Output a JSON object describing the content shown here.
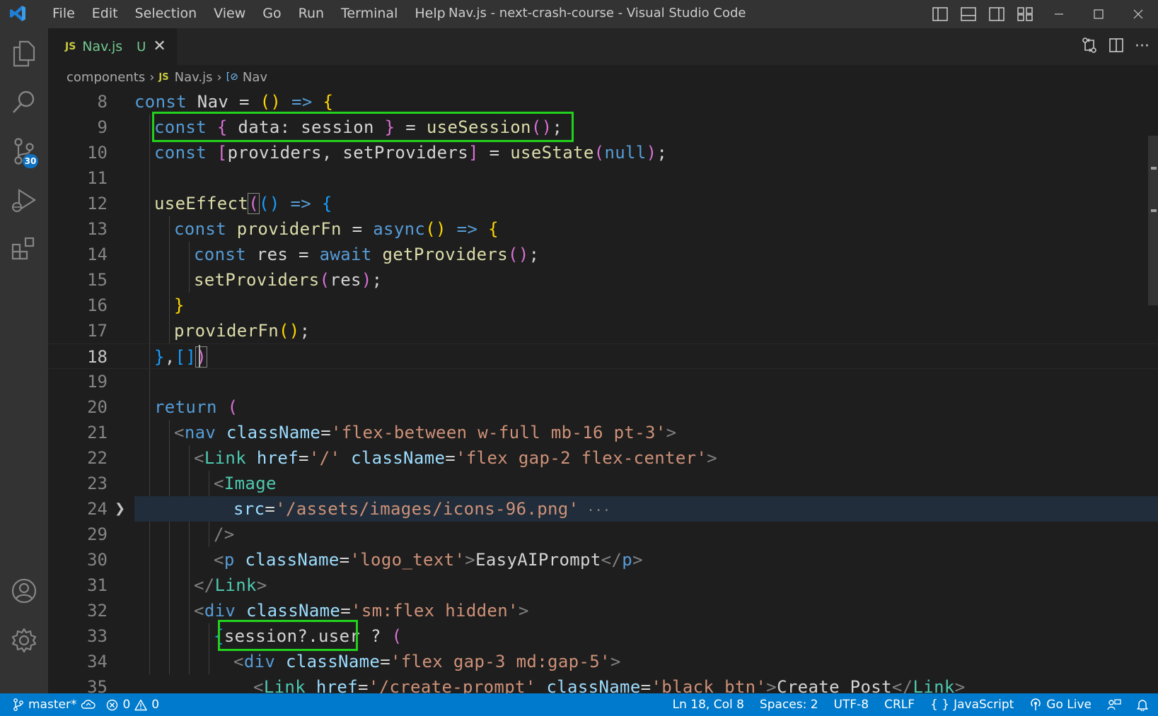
{
  "window": {
    "title": "Nav.js - next-crash-course - Visual Studio Code",
    "menu": [
      "File",
      "Edit",
      "Selection",
      "View",
      "Go",
      "Run",
      "Terminal",
      "Help"
    ]
  },
  "activity_bar": {
    "items": [
      "explorer-icon",
      "search-icon",
      "source-control-icon",
      "run-debug-icon",
      "extensions-icon"
    ],
    "source_control_badge": "30",
    "bottom": [
      "accounts-icon",
      "manage-gear-icon"
    ]
  },
  "tab": {
    "lang_badge": "JS",
    "filename": "Nav.js",
    "status": "U"
  },
  "breadcrumb": {
    "folder": "components",
    "file_badge": "JS",
    "file": "Nav.js",
    "symbol_icon": "[⊘",
    "symbol": "Nav"
  },
  "editor": {
    "current_line": "18",
    "lines": [
      {
        "n": "8"
      },
      {
        "n": "9"
      },
      {
        "n": "10"
      },
      {
        "n": "11"
      },
      {
        "n": "12"
      },
      {
        "n": "13"
      },
      {
        "n": "14"
      },
      {
        "n": "15"
      },
      {
        "n": "16"
      },
      {
        "n": "17"
      },
      {
        "n": "18"
      },
      {
        "n": "19"
      },
      {
        "n": "20"
      },
      {
        "n": "21"
      },
      {
        "n": "22"
      },
      {
        "n": "23"
      },
      {
        "n": "24"
      },
      {
        "n": "29"
      },
      {
        "n": "30"
      },
      {
        "n": "31"
      },
      {
        "n": "32"
      },
      {
        "n": "33"
      },
      {
        "n": "34"
      },
      {
        "n": "35"
      }
    ],
    "code": {
      "l8": {
        "t1": "const",
        "t2": " Nav ",
        "t3": "=",
        "t4": " ",
        "t5": "()",
        "t6": " ",
        "t7": "=>",
        "t8": " ",
        "t9": "{"
      },
      "l9": {
        "t1": "const",
        "t2": " ",
        "t3": "{",
        "t4": " data: session ",
        "t5": "}",
        "t6": " = ",
        "t7": "useSession",
        "t8": "()",
        "t9": ";"
      },
      "l10": {
        "t1": "const",
        "t2": " ",
        "t3": "[",
        "t4": "providers, setProviders",
        "t5": "]",
        "t6": " = ",
        "t7": "useState",
        "t8": "(",
        "t9": "null",
        "t10": ")",
        "t11": ";"
      },
      "l12": {
        "t1": "useEffect",
        "t2": "(",
        "t3": "()",
        "t4": " ",
        "t5": "=>",
        "t6": " ",
        "t7": "{"
      },
      "l13": {
        "t1": "const",
        "t2": " providerFn ",
        "t3": "=",
        "t4": " ",
        "t5": "async",
        "t6": "()",
        "t7": " ",
        "t8": "=>",
        "t9": " ",
        "t10": "{"
      },
      "l14": {
        "t1": "const",
        "t2": " res ",
        "t3": "=",
        "t4": " ",
        "t5": "await",
        "t6": " ",
        "t7": "getProviders",
        "t8": "()",
        "t9": ";"
      },
      "l15": {
        "t1": "setProviders",
        "t2": "(",
        "t3": "res",
        "t4": ")",
        "t5": ";"
      },
      "l16": {
        "t1": "}"
      },
      "l17": {
        "t1": "providerFn",
        "t2": "()",
        "t3": ";"
      },
      "l18": {
        "t1": "}",
        "t2": ",",
        "t3": "[]",
        "t4": ")"
      },
      "l20": {
        "t1": "return",
        "t2": " ",
        "t3": "("
      },
      "l21": {
        "t1": "<",
        "t2": "nav",
        "t3": " ",
        "t4": "className",
        "t5": "=",
        "t6": "'flex-between w-full mb-16 pt-3'",
        "t7": ">"
      },
      "l22": {
        "t1": "<",
        "t2": "Link",
        "t3": " ",
        "t4": "href",
        "t5": "=",
        "t6": "'/'",
        "t7": " ",
        "t8": "className",
        "t9": "=",
        "t10": "'flex gap-2 flex-center'",
        "t11": ">"
      },
      "l23": {
        "t1": "<",
        "t2": "Image"
      },
      "l24": {
        "t1": "src",
        "t2": "=",
        "t3": "'/assets/images/icons-96.png'",
        "t4": " ···"
      },
      "l29": {
        "t1": "/>"
      },
      "l30": {
        "t1": "<",
        "t2": "p",
        "t3": " ",
        "t4": "className",
        "t5": "=",
        "t6": "'logo_text'",
        "t7": ">",
        "t8": "EasyAIPrompt",
        "t9": "</",
        "t10": "p",
        "t11": ">"
      },
      "l31": {
        "t1": "</",
        "t2": "Link",
        "t3": ">"
      },
      "l32": {
        "t1": "<",
        "t2": "div",
        "t3": " ",
        "t4": "className",
        "t5": "=",
        "t6": "'sm:flex hidden'",
        "t7": ">"
      },
      "l33": {
        "t1": "{",
        "t2": "session?.user",
        "t3": " ? ",
        "t4": "("
      },
      "l34": {
        "t1": "<",
        "t2": "div",
        "t3": " ",
        "t4": "className",
        "t5": "=",
        "t6": "'flex gap-3 md:gap-5'",
        "t7": ">"
      },
      "l35": {
        "t1": "<",
        "t2": "Link",
        "t3": " ",
        "t4": "href",
        "t5": "=",
        "t6": "'/create-prompt'",
        "t7": " ",
        "t8": "className",
        "t9": "=",
        "t10": "'black_btn'",
        "t11": ">",
        "t12": "Create Post",
        "t13": "</",
        "t14": "Link",
        "t15": ">"
      }
    }
  },
  "status_bar": {
    "branch": "master*",
    "errors": "0",
    "warnings": "0",
    "position": "Ln 18, Col 8",
    "spaces": "Spaces: 2",
    "encoding": "UTF-8",
    "eol": "CRLF",
    "language": "JavaScript",
    "language_icon": "{ }",
    "go_live": "Go Live"
  },
  "colors": {
    "accent": "#007acc",
    "highlight_box": "#22d11e",
    "keyword": "#569cd6",
    "function": "#dcdcaa",
    "string": "#ce9178",
    "jsx_tag": "#4ec9b0"
  }
}
